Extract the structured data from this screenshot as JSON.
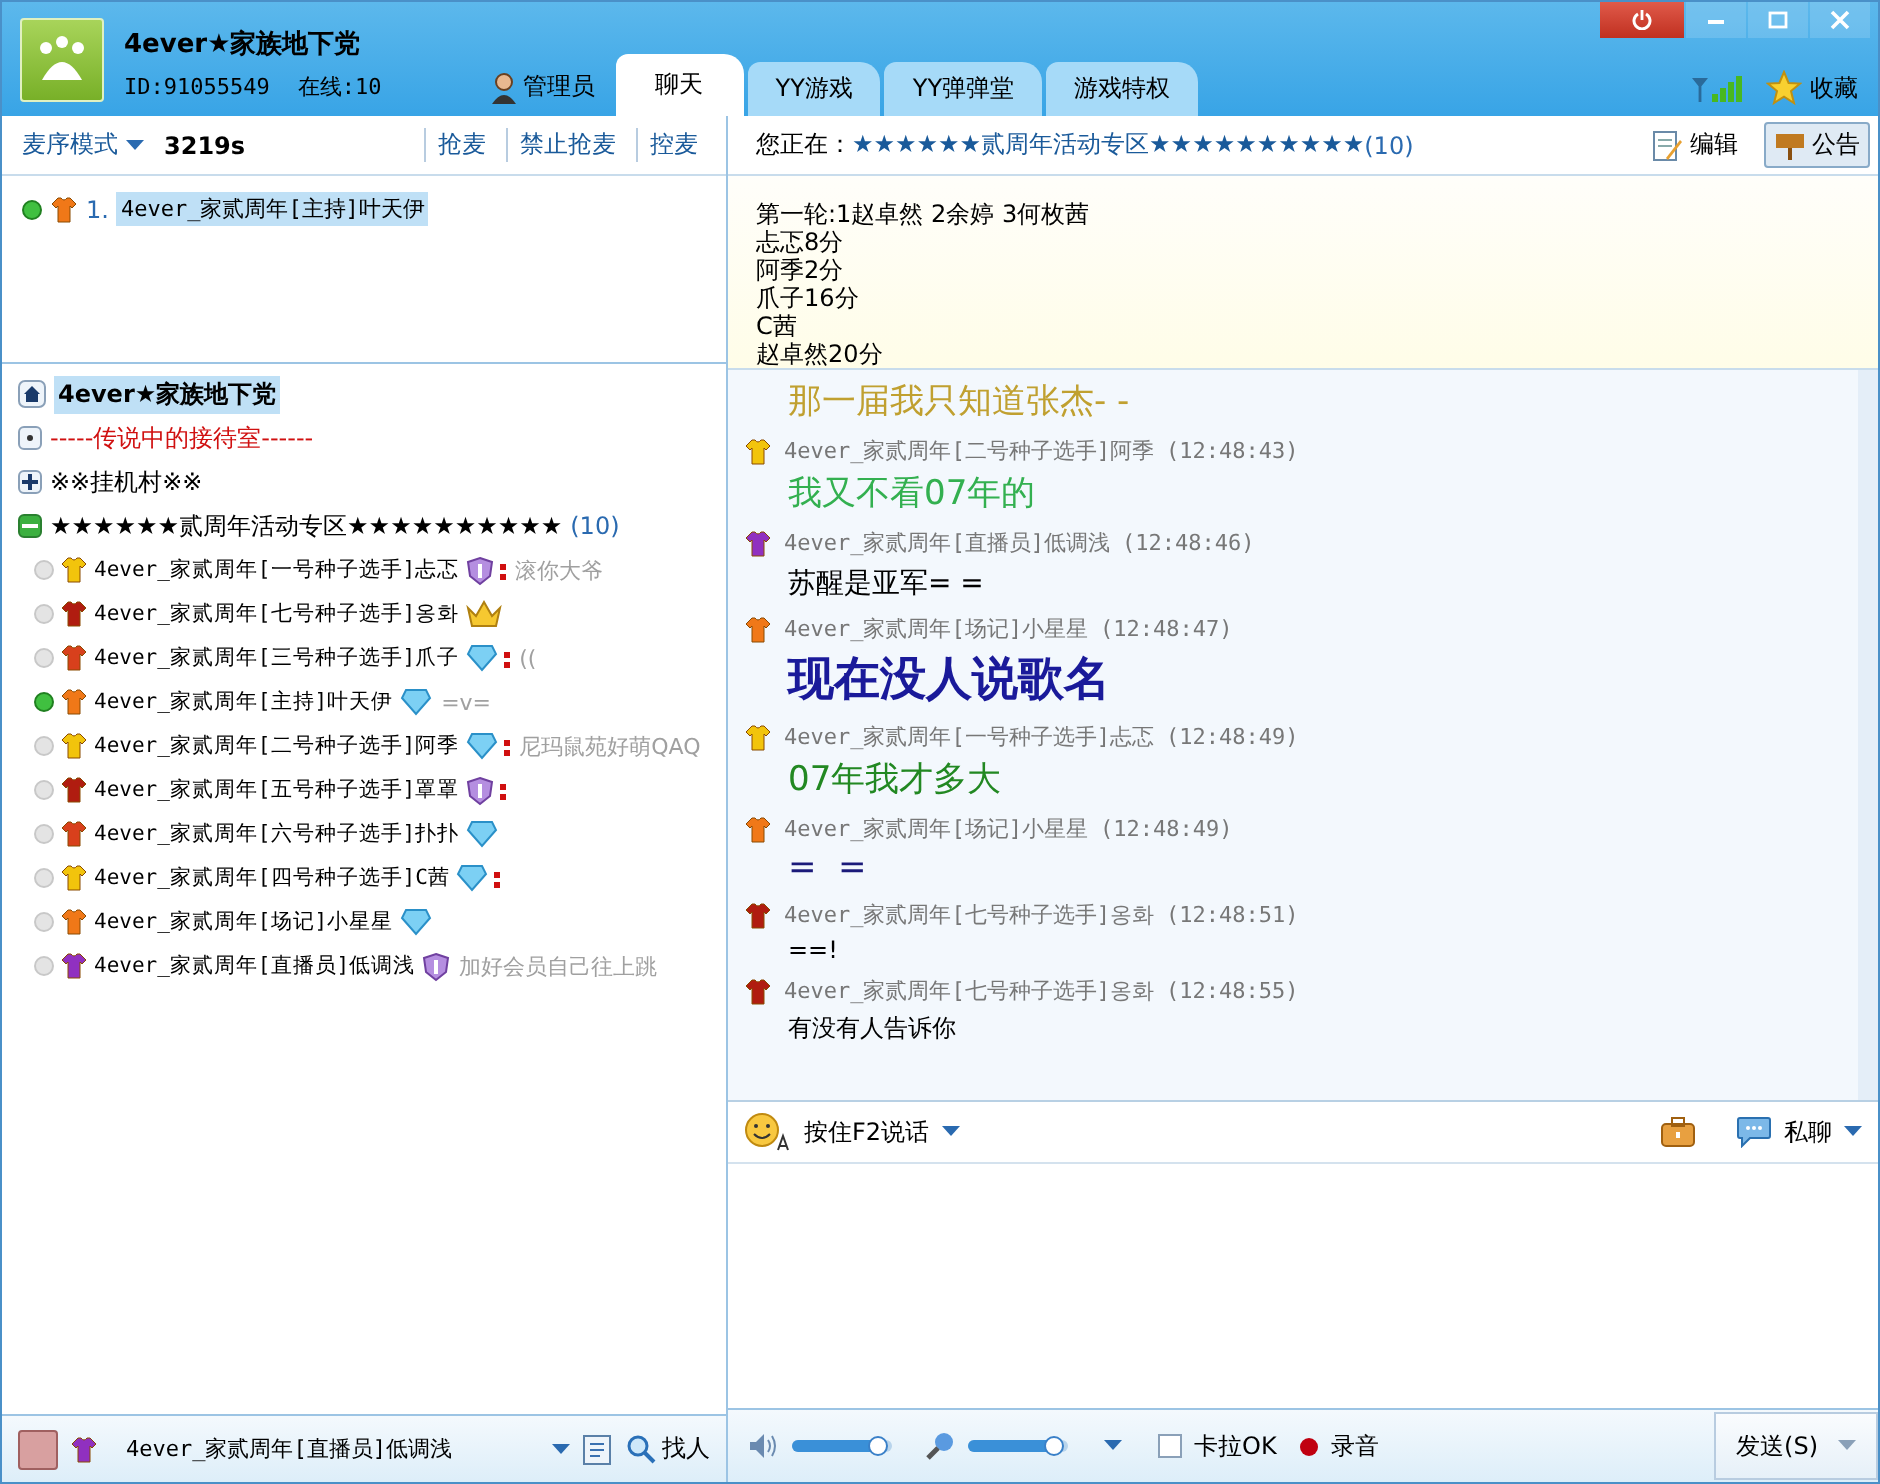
{
  "title_bar": {
    "channel_name": "4ever★家族地下党",
    "id": "ID:91055549",
    "online": "在线:10",
    "role": "管理员",
    "favorite": "收藏"
  },
  "tabs": [
    {
      "label": "聊天",
      "selected": true
    },
    {
      "label": "YY游戏",
      "selected": false
    },
    {
      "label": "YY弹弹堂",
      "selected": false
    },
    {
      "label": "游戏特权",
      "selected": false
    }
  ],
  "left_toolbar": {
    "mode": "麦序模式",
    "timer": "3219s",
    "links": [
      "抢麦",
      "禁止抢麦",
      "控麦"
    ]
  },
  "mic_queue": [
    {
      "index": "1.",
      "name": "4ever_家贰周年[主持]叶天伊",
      "color": "#f07818",
      "speaking": true,
      "selected": true
    }
  ],
  "tree": {
    "root": {
      "label": "4ever★家族地下党",
      "selected": true
    },
    "groups": [
      {
        "label": "-----传说中的接待室------",
        "kind": "reception",
        "expanded": false
      },
      {
        "label": "※※挂机村※※",
        "kind": "room",
        "expanded": false
      },
      {
        "label": "★★★★★★贰周年活动专区★★★★★★★★★★",
        "count": "(10)",
        "kind": "room",
        "expanded": true,
        "children": [
          {
            "name": "4ever_家贰周年[一号种子选手]忐忑",
            "color": "#f2c40c",
            "kind": "shield",
            "mark": true,
            "signature": "滚你大爷",
            "speaking": false
          },
          {
            "name": "4ever_家贰周年[七号种子选手]옹화",
            "color": "#b01c10",
            "kind": "crown",
            "mark": false,
            "speaking": false
          },
          {
            "name": "4ever_家贰周年[三号种子选手]爪子",
            "color": "#d8401c",
            "kind": "diamond",
            "mark": true,
            "signature": "((",
            "speaking": false
          },
          {
            "name": "4ever_家贰周年[主持]叶天伊",
            "color": "#f07818",
            "kind": "diamond",
            "mark": false,
            "signature": "=v=",
            "speaking": true
          },
          {
            "name": "4ever_家贰周年[二号种子选手]阿季",
            "color": "#f2c40c",
            "kind": "diamond",
            "mark": true,
            "signature": "尼玛鼠苑好萌QAQ",
            "speaking": false
          },
          {
            "name": "4ever_家贰周年[五号种子选手]罩罩",
            "color": "#b01c10",
            "kind": "shield",
            "mark": true,
            "speaking": false
          },
          {
            "name": "4ever_家贰周年[六号种子选手]扑扑",
            "color": "#d8401c",
            "kind": "diamond",
            "mark": false,
            "speaking": false
          },
          {
            "name": "4ever_家贰周年[四号种子选手]C茜",
            "color": "#f2c40c",
            "kind": "diamond",
            "mark": true,
            "speaking": false
          },
          {
            "name": "4ever_家贰周年[场记]小星星",
            "color": "#f07818",
            "kind": "diamond",
            "mark": false,
            "speaking": false
          },
          {
            "name": "4ever_家贰周年[直播员]低调浅",
            "color": "#9030c0",
            "kind": "shield",
            "mark": false,
            "signature": "加好会员自己往上跳",
            "speaking": false
          }
        ]
      }
    ]
  },
  "channel_header": {
    "prefix": "您正在：",
    "room": "★★★★★★贰周年活动专区★★★★★★★★★★",
    "count": "(10)",
    "edit": "编辑",
    "notice": "公告"
  },
  "announcement": [
    "第一轮:1赵卓然 2余婷 3何枚茜",
    "忐忑8分",
    "阿季2分",
    "爪子16分",
    "C茜",
    "赵卓然20分"
  ],
  "messages": [
    {
      "text": "那一届我只知道张杰- -",
      "color": "#c0a030",
      "kind": "medium"
    },
    {
      "header": {
        "sender": "4ever_家贰周年[二号种子选手]阿季",
        "time": "(12:48:43)",
        "color": "#f2c40c"
      },
      "text": "我又不看07年的",
      "color": "#33b050",
      "kind": "medium"
    },
    {
      "header": {
        "sender": "4ever_家贰周年[直播员]低调浅",
        "time": "(12:48:46)",
        "color": "#9030c0"
      },
      "text": "苏醒是亚军= =",
      "color": "#000000",
      "kind": "normal"
    },
    {
      "header": {
        "sender": "4ever_家贰周年[场记]小星星",
        "time": "(12:48:47)",
        "color": "#f07818"
      },
      "text": "现在没人说歌名",
      "color": "#1a1a9a",
      "kind": "large"
    },
    {
      "header": {
        "sender": "4ever_家贰周年[一号种子选手]忐忑",
        "time": "(12:48:49)",
        "color": "#f2c40c"
      },
      "text": "07年我才多大",
      "color": "#228822",
      "kind": "medium"
    },
    {
      "header": {
        "sender": "4ever_家贰周年[场记]小星星",
        "time": "(12:48:49)",
        "color": "#f07818"
      },
      "text": "=  =",
      "color": "#1a1a7a",
      "kind": "medium"
    },
    {
      "header": {
        "sender": "4ever_家贰周年[七号种子选手]옹화",
        "time": "(12:48:51)",
        "color": "#b01c10"
      },
      "text": "==!",
      "color": "#000000",
      "kind": "small"
    },
    {
      "header": {
        "sender": "4ever_家贰周年[七号种子选手]옹화",
        "time": "(12:48:55)",
        "color": "#b01c10"
      },
      "text": "有没有人告诉你",
      "color": "#000000",
      "kind": "small"
    }
  ],
  "input_toolbar": {
    "talk": "按住F2说话",
    "private": "私聊"
  },
  "bottom_left": {
    "name": "4ever_家贰周年[直播员]低调浅",
    "find": "找人"
  },
  "bottom_right": {
    "speaker": {
      "level": 0.85
    },
    "mic": {
      "level": 0.85
    },
    "karaoke": {
      "label": "卡拉OK",
      "checked": false
    },
    "record": "录音",
    "send": "发送(S)"
  }
}
